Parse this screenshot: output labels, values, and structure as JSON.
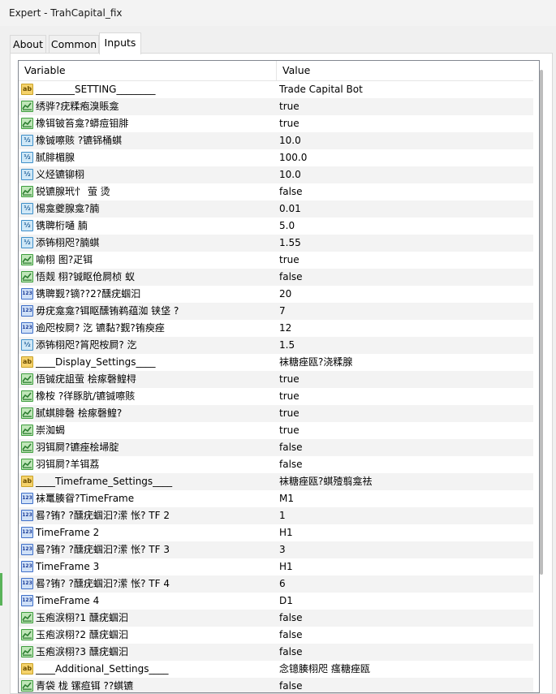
{
  "window": {
    "title": "Expert - TrahCapital_fix"
  },
  "tabs": [
    {
      "label": "About"
    },
    {
      "label": "Common"
    },
    {
      "label": "Inputs"
    }
  ],
  "table": {
    "columns": {
      "variable": "Variable",
      "value": "Value"
    },
    "rows": [
      {
        "icon": "ab",
        "variable": "________SETTING________",
        "value": "Trade Capital Bot"
      },
      {
        "icon": "bool",
        "variable": "绣骅?疣糅疱溴賬龛",
        "value": "true"
      },
      {
        "icon": "bool",
        "variable": "橡铒铍笞龛?蟒痘钼腓",
        "value": "true"
      },
      {
        "icon": "double",
        "variable": "橡铖嚓赅 ?镳铞桶蜞",
        "value": "10.0"
      },
      {
        "icon": "double",
        "variable": "腻腓楣腺",
        "value": "100.0"
      },
      {
        "icon": "double",
        "variable": "义烃镳铆栩",
        "value": "10.0"
      },
      {
        "icon": "bool",
        "variable": "锐镳腺玳忄 萤 烫",
        "value": "false"
      },
      {
        "icon": "double",
        "variable": "惕龛夔腺龛?腩",
        "value": "0.01"
      },
      {
        "icon": "double",
        "variable": "镌聛桁嗵       腩",
        "value": "5.0"
      },
      {
        "icon": "double",
        "variable": "添钸栩咫?腩蜞",
        "value": "1.55"
      },
      {
        "icon": "bool",
        "variable": "喻栩    图?疋铒",
        "value": "true"
      },
      {
        "icon": "bool",
        "variable": "悟觌     栩?铖眍伧屙桢 蚁",
        "value": "false"
      },
      {
        "icon": "int",
        "variable": "镌聛觐?镝??2?醺疣蝈汩",
        "value": "20"
      },
      {
        "icon": "int",
        "variable": "毋疣龛龛?铒眍醺铕鹈蕴洳 铗垡    ?",
        "value": "7"
      },
      {
        "icon": "int",
        "variable": "逾咫桉屙?     汔 镳黏?觐?铕瘐痤",
        "value": "12"
      },
      {
        "icon": "double",
        "variable": "添钸栩咫?筲咫桉屙?     汔",
        "value": "1.5"
      },
      {
        "icon": "ab",
        "variable": "____Display_Settings____",
        "value": "袜糖痤瓯?浇糅腺"
      },
      {
        "icon": "bool",
        "variable": "悟铖疣詛萤 桧瘃磬鳇桪",
        "value": "true"
      },
      {
        "icon": "bool",
        "variable": "橡桉    ?徉豚肮/镳铖嚓赅",
        "value": "true"
      },
      {
        "icon": "bool",
        "variable": "腻蜞腓磬     桧瘃磬鳇?",
        "value": "true"
      },
      {
        "icon": "bool",
        "variable": "崇洳蝎",
        "value": "true"
      },
      {
        "icon": "bool",
        "variable": "羽铒屙?镳痤桧埽腚",
        "value": "false"
      },
      {
        "icon": "bool",
        "variable": "羽铒屙?羊铒荔",
        "value": "false"
      },
      {
        "icon": "ab",
        "variable": "____Timeframe_Settings____",
        "value": "袜糖痤瓯?蜞殪翦龛祛"
      },
      {
        "icon": "int",
        "variable": "袜鼍腠眢?TimeFrame",
        "value": "M1"
      },
      {
        "icon": "int",
        "variable": "晷?铕? ?醺疣蝈汩?潆    怅? TF 2",
        "value": "1"
      },
      {
        "icon": "int",
        "variable": "TimeFrame 2",
        "value": "H1"
      },
      {
        "icon": "int",
        "variable": "晷?铕? ?醺疣蝈汩?潆    怅? TF 3",
        "value": "3"
      },
      {
        "icon": "int",
        "variable": "TimeFrame 3",
        "value": "H1"
      },
      {
        "icon": "int",
        "variable": "晷?铕? ?醺疣蝈汩?潆    怅? TF 4",
        "value": "6"
      },
      {
        "icon": "int",
        "variable": "TimeFrame 4",
        "value": "D1"
      },
      {
        "icon": "bool",
        "variable": "玉疱涙栩?1 醺疣蝈汩",
        "value": "false"
      },
      {
        "icon": "bool",
        "variable": "玉疱涙栩?2 醺疣蝈汩",
        "value": "false"
      },
      {
        "icon": "bool",
        "variable": "玉疱涙栩?3 醺疣蝈汩",
        "value": "false"
      },
      {
        "icon": "ab",
        "variable": "____Additional_Settings____",
        "value": "念镱腠栩咫       瘙糖痤瓯"
      },
      {
        "icon": "bool",
        "variable": "青袋  栊 镙疸铒 ??蜞镳",
        "value": "false"
      }
    ]
  },
  "icon_styles": {
    "ab": {
      "name": "string-icon",
      "glyph": "ab",
      "bg": "#f5d26b",
      "border": "#c9a227",
      "fg": "#6b4e00"
    },
    "bool": {
      "name": "bool-icon",
      "glyph": "",
      "bg": "#bfe6b8",
      "border": "#3f9e3f",
      "fg": "#2e7d32"
    },
    "double": {
      "name": "double-icon",
      "glyph": "½",
      "bg": "#cfe8f7",
      "border": "#3f8fc8",
      "fg": "#1f5f99"
    },
    "int": {
      "name": "int-icon",
      "glyph": "123",
      "bg": "#cfe0f7",
      "border": "#3f6fc8",
      "fg": "#1f3f99"
    }
  }
}
